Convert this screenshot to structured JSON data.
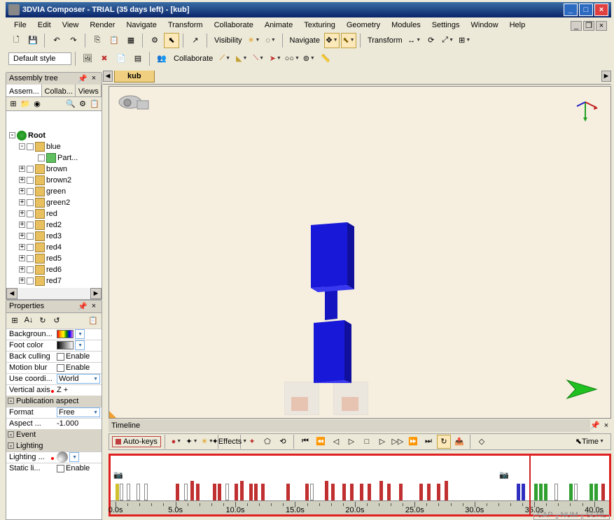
{
  "title": "3DVIA Composer - TRIAL (35 days left) - [kub]",
  "menu": [
    "File",
    "Edit",
    "View",
    "Render",
    "Navigate",
    "Transform",
    "Collaborate",
    "Animate",
    "Texturing",
    "Geometry",
    "Modules",
    "Settings",
    "Window",
    "Help"
  ],
  "toolbar_labels": {
    "visibility": "Visibility",
    "navigate": "Navigate",
    "transform": "Transform",
    "default_style": "Default style",
    "collaborate": "Collaborate"
  },
  "doc_tab": "kub",
  "timeline": {
    "title": "Timeline",
    "auto_keys": "Auto-keys",
    "effects": "Effects",
    "time_btn": "Time",
    "ticks": [
      "0.0s",
      "5.0s",
      "10.0s",
      "15.0s",
      "20.0s",
      "25.0s",
      "30.0s",
      "35.0s",
      "40.0s"
    ],
    "keys": [
      {
        "pos": 1.0,
        "cls": "yellow"
      },
      {
        "pos": 1.8,
        "cls": "white"
      },
      {
        "pos": 3.2,
        "cls": "white"
      },
      {
        "pos": 5.2,
        "cls": "white"
      },
      {
        "pos": 6.8,
        "cls": "white"
      },
      {
        "pos": 13.0,
        "cls": "red"
      },
      {
        "pos": 14.8,
        "cls": "white"
      },
      {
        "pos": 16.0,
        "cls": "red tall"
      },
      {
        "pos": 17.2,
        "cls": "red"
      },
      {
        "pos": 20.5,
        "cls": "red"
      },
      {
        "pos": 21.5,
        "cls": "red"
      },
      {
        "pos": 23.0,
        "cls": "white"
      },
      {
        "pos": 24.8,
        "cls": "red"
      },
      {
        "pos": 26.0,
        "cls": "red tall"
      },
      {
        "pos": 27.8,
        "cls": "red"
      },
      {
        "pos": 28.8,
        "cls": "red"
      },
      {
        "pos": 30.2,
        "cls": "red"
      },
      {
        "pos": 35.2,
        "cls": "red"
      },
      {
        "pos": 39.0,
        "cls": "red"
      },
      {
        "pos": 40.0,
        "cls": "white"
      },
      {
        "pos": 43.0,
        "cls": "red tall"
      },
      {
        "pos": 44.2,
        "cls": "red"
      },
      {
        "pos": 46.5,
        "cls": "red"
      },
      {
        "pos": 48.0,
        "cls": "red"
      },
      {
        "pos": 50.0,
        "cls": "red"
      },
      {
        "pos": 51.5,
        "cls": "red"
      },
      {
        "pos": 54.0,
        "cls": "red tall"
      },
      {
        "pos": 55.5,
        "cls": "red"
      },
      {
        "pos": 57.8,
        "cls": "red"
      },
      {
        "pos": 62.0,
        "cls": "red"
      },
      {
        "pos": 63.5,
        "cls": "red"
      },
      {
        "pos": 65.5,
        "cls": "red"
      },
      {
        "pos": 67.0,
        "cls": "red tall"
      },
      {
        "pos": 81.5,
        "cls": "blue"
      },
      {
        "pos": 82.5,
        "cls": "blue"
      },
      {
        "pos": 85.0,
        "cls": "green"
      },
      {
        "pos": 86.0,
        "cls": "green"
      },
      {
        "pos": 87.0,
        "cls": "green"
      },
      {
        "pos": 89.0,
        "cls": "white"
      },
      {
        "pos": 92.0,
        "cls": "green"
      },
      {
        "pos": 93.0,
        "cls": "white"
      },
      {
        "pos": 96.0,
        "cls": "green"
      },
      {
        "pos": 97.0,
        "cls": "green"
      },
      {
        "pos": 98.5,
        "cls": "red"
      }
    ],
    "playhead_pos": 84.0,
    "cam_markers": [
      0.6,
      78.0
    ]
  },
  "assembly": {
    "title": "Assembly tree",
    "tabs": [
      "Assem...",
      "Collab...",
      "Views"
    ],
    "tree": [
      {
        "indent": 0,
        "exp": "-",
        "icon": "root",
        "label": "Root",
        "bold": true
      },
      {
        "indent": 1,
        "exp": "-",
        "icon": "prj",
        "chk": true,
        "label": "blue"
      },
      {
        "indent": 2,
        "exp": "",
        "icon": "part",
        "chk": true,
        "label": "Part..."
      },
      {
        "indent": 1,
        "exp": "+",
        "icon": "prj",
        "chk": true,
        "label": "brown"
      },
      {
        "indent": 1,
        "exp": "+",
        "icon": "prj",
        "chk": true,
        "label": "brown2"
      },
      {
        "indent": 1,
        "exp": "+",
        "icon": "prj",
        "chk": true,
        "label": "green"
      },
      {
        "indent": 1,
        "exp": "+",
        "icon": "prj",
        "chk": true,
        "label": "green2"
      },
      {
        "indent": 1,
        "exp": "+",
        "icon": "prj",
        "chk": true,
        "label": "red"
      },
      {
        "indent": 1,
        "exp": "+",
        "icon": "prj",
        "chk": true,
        "label": "red2"
      },
      {
        "indent": 1,
        "exp": "+",
        "icon": "prj",
        "chk": true,
        "label": "red3"
      },
      {
        "indent": 1,
        "exp": "+",
        "icon": "prj",
        "chk": true,
        "label": "red4"
      },
      {
        "indent": 1,
        "exp": "+",
        "icon": "prj",
        "chk": true,
        "label": "red5"
      },
      {
        "indent": 1,
        "exp": "+",
        "icon": "prj",
        "chk": true,
        "label": "red6"
      },
      {
        "indent": 1,
        "exp": "+",
        "icon": "prj",
        "chk": true,
        "label": "red7"
      }
    ]
  },
  "properties": {
    "title": "Properties",
    "groups": [
      {
        "cat": null,
        "rows": [
          {
            "label": "Backgroun...",
            "type": "color",
            "cls": "gradient-rainbow",
            "arrow": true
          },
          {
            "label": "Foot color",
            "type": "color",
            "cls": "gradient-rainbow",
            "style": "background: linear-gradient(to right,#000,#888,#fff);",
            "arrow": true
          },
          {
            "label": "Back culling",
            "type": "check",
            "value": "Enable"
          },
          {
            "label": "Motion blur",
            "type": "check",
            "value": "Enable"
          },
          {
            "label": "Use coordi...",
            "type": "combo",
            "value": "World"
          },
          {
            "label": "Vertical axis",
            "type": "text",
            "value": "Z +",
            "red_dot": true
          }
        ]
      },
      {
        "cat": "Publication aspect",
        "rows": [
          {
            "label": "Format",
            "type": "combo",
            "value": "Free"
          },
          {
            "label": "Aspect ...",
            "type": "text",
            "value": "-1.000"
          }
        ]
      },
      {
        "cat": "Event",
        "rows": []
      },
      {
        "cat": "Lighting",
        "rows": [
          {
            "label": "Lighting ...",
            "type": "sphere",
            "red_dot": true,
            "arrow": true
          },
          {
            "label": "Static li...",
            "type": "check",
            "value": "Enable"
          }
        ]
      }
    ]
  },
  "status_cells": [
    "CAP",
    "NUM",
    "SCRL"
  ]
}
